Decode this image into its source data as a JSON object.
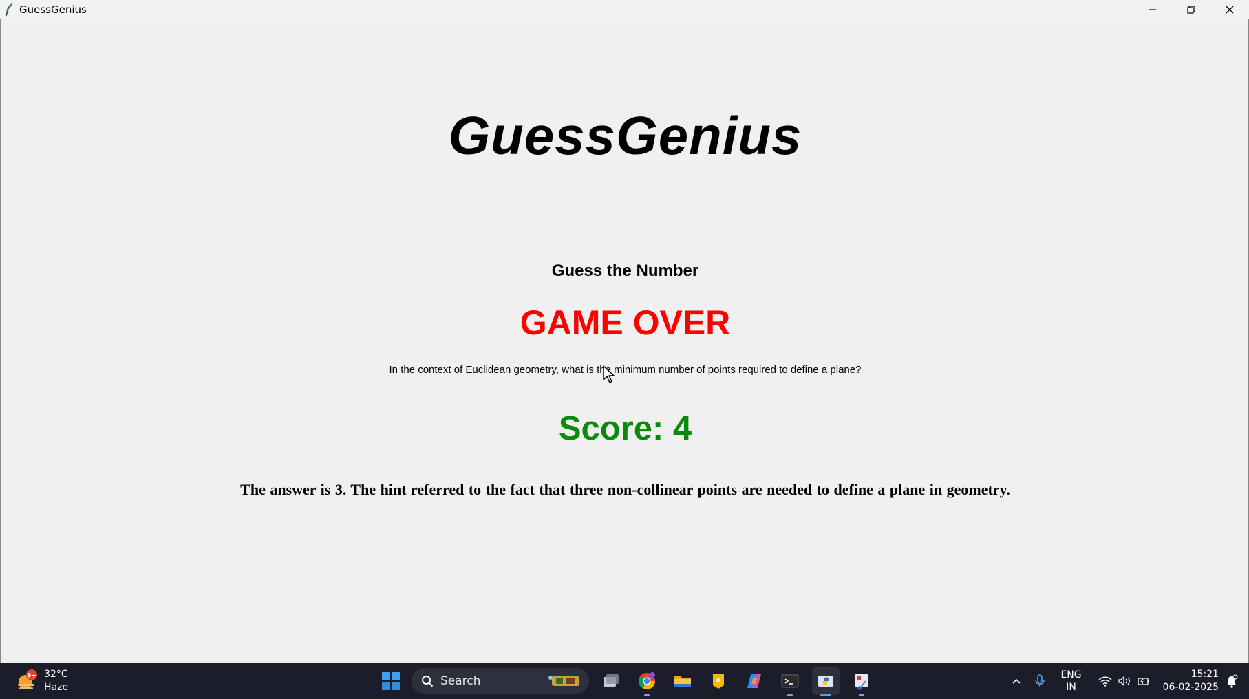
{
  "window": {
    "title": "GuessGenius"
  },
  "app": {
    "logo_title": "GuessGenius",
    "subtitle": "Guess the Number",
    "status": "GAME OVER",
    "question": "In the context of Euclidean geometry, what is the minimum number of points required to define a plane?",
    "score": "Score: 4",
    "answer": "The answer is 3.  The hint referred to the fact that three non-collinear points are needed to define a plane in geometry.",
    "colors": {
      "status": "#ff0000",
      "score": "#0a8a0a"
    }
  },
  "taskbar": {
    "weather": {
      "temp": "32°C",
      "condition": "Haze",
      "badge": "9+"
    },
    "search_placeholder": "Search",
    "apps": [
      "windows-start-icon",
      "task-view-icon",
      "chrome-icon",
      "file-explorer-icon",
      "notes-icon",
      "copilot-icon",
      "terminal-icon",
      "python-icon",
      "snipping-tool-icon"
    ],
    "language": {
      "line1": "ENG",
      "line2": "IN"
    },
    "clock": {
      "time": "15:21",
      "date": "06-02-2025"
    }
  }
}
